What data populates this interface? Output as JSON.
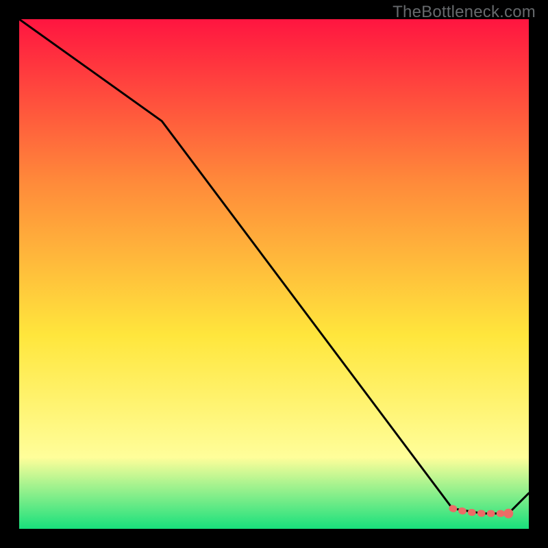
{
  "watermark": "TheBottleneck.com",
  "colors": {
    "gradient_top": "#FF1540",
    "gradient_mid_upper": "#FF8A3A",
    "gradient_mid": "#FFE63C",
    "gradient_low": "#FFFE9A",
    "gradient_bottom": "#18E07C",
    "curve": "#000000",
    "marker_stroke": "#EC6B66",
    "marker_fill": "#EC6B66",
    "background": "#000000"
  },
  "chart_data": {
    "type": "line",
    "title": "",
    "xlabel": "",
    "ylabel": "",
    "xlim": [
      0,
      100
    ],
    "ylim": [
      0,
      100
    ],
    "series": [
      {
        "name": "curve",
        "x": [
          0,
          28,
          85,
          91,
          96,
          100
        ],
        "y": [
          100,
          80,
          4,
          3,
          3,
          7
        ]
      }
    ],
    "markers": {
      "name": "highlight",
      "x": [
        85,
        86.5,
        88,
        89.5,
        91,
        92.5,
        94,
        96
      ],
      "y": [
        4,
        3.6,
        3.3,
        3.15,
        3,
        3,
        3,
        3
      ]
    },
    "marker_endpoint": {
      "x": 96,
      "y": 3
    }
  }
}
